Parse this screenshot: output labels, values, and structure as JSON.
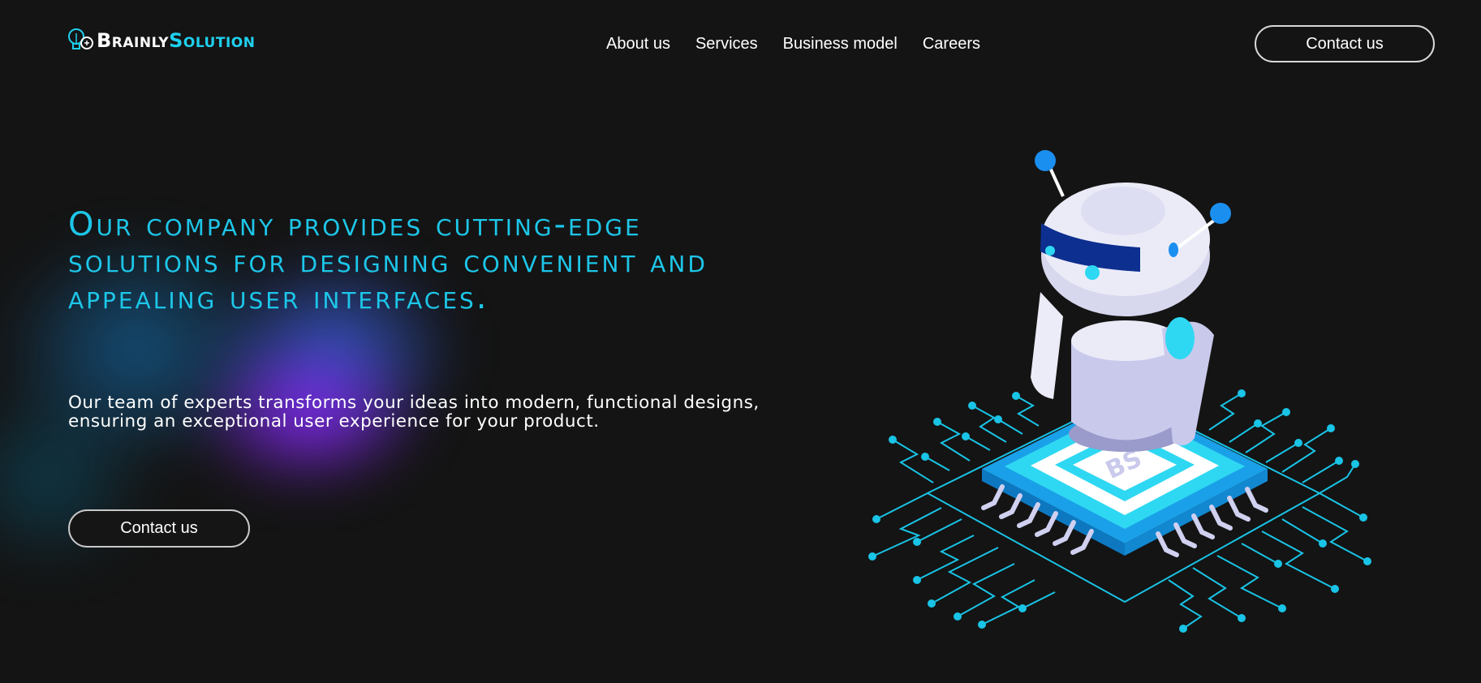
{
  "brand": {
    "name_part1": "Brainly",
    "name_part2": "Solution",
    "accent": "#1fd0ee"
  },
  "nav": {
    "items": [
      "About us",
      "Services",
      "Business model",
      "Careers"
    ],
    "contact_label": "Contact us"
  },
  "hero": {
    "headline": "Our company provides cutting-edge solutions for designing convenient and appealing user interfaces.",
    "subtext": "Our team of experts transforms your ideas into modern, functional designs, ensuring an exceptional user experience for your product.",
    "cta_label": "Contact us"
  },
  "illustration": {
    "chip_label": "BS",
    "icon": "robot-on-chip-illustration"
  },
  "colors": {
    "background": "#141414",
    "headline": "#1dc6e8",
    "circuit": "#19c4e6",
    "robot_body": "#d9d9f0"
  }
}
